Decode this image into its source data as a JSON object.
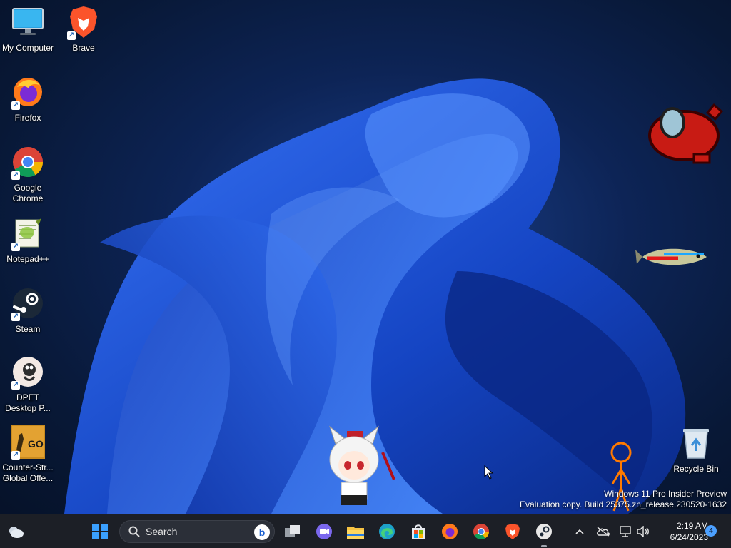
{
  "desktop": {
    "icons": [
      {
        "label": "My Computer",
        "icon": "monitor-icon",
        "shortcut": false
      },
      {
        "label": "Brave",
        "icon": "brave-icon",
        "shortcut": true
      },
      {
        "label": "Firefox",
        "icon": "firefox-icon",
        "shortcut": true
      },
      {
        "label": "Google\nChrome",
        "icon": "chrome-icon",
        "shortcut": true
      },
      {
        "label": "Notepad++",
        "icon": "notepadpp-icon",
        "shortcut": true
      },
      {
        "label": "Steam",
        "icon": "steam-icon",
        "shortcut": true
      },
      {
        "label": "DPET\nDesktop P...",
        "icon": "dpet-icon",
        "shortcut": true
      },
      {
        "label": "Counter-Str...\nGlobal Offe...",
        "icon": "csgo-icon",
        "shortcut": true
      },
      {
        "label": "Recycle Bin",
        "icon": "recycle-bin-icon",
        "shortcut": false
      }
    ],
    "watermark": {
      "line1": "Windows 11 Pro Insider Preview",
      "line2": "Evaluation copy. Build 25375.zn_release.230520-1632"
    }
  },
  "taskbar": {
    "search_placeholder": "Search",
    "search_badge": "b",
    "pinned": [
      "start-icon",
      "task-view-icon",
      "teams-chat-icon",
      "file-explorer-icon",
      "edge-icon",
      "store-icon",
      "firefox-icon",
      "chrome-icon",
      "brave-icon",
      "steam-icon"
    ],
    "tray": {
      "time": "2:19 AM",
      "date": "6/24/2023",
      "notification_count": "4"
    }
  },
  "colors": {
    "taskbar_bg": "#1c1f26",
    "accent": "#4ca0ff",
    "wallpaper_base": "#0d2456"
  }
}
